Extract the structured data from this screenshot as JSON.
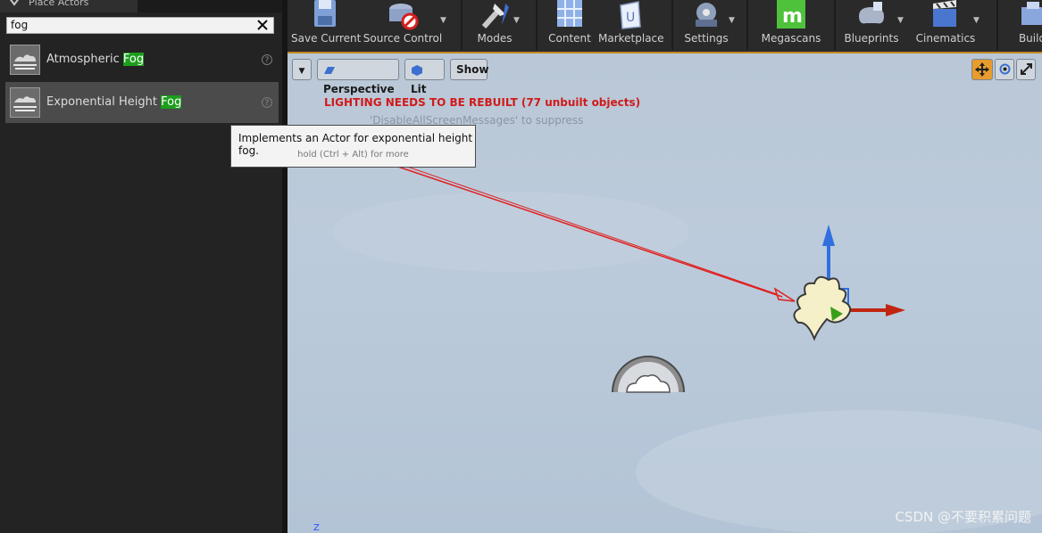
{
  "panel": {
    "tab_label": "Place Actors",
    "search_value": "fog",
    "items": [
      {
        "prefix": "Atmospheric ",
        "match": "Fog"
      },
      {
        "prefix": "Exponential Height ",
        "match": "Fog"
      }
    ],
    "help_glyph": "?"
  },
  "toolbar": {
    "buttons": [
      {
        "label": "Save Current",
        "icon": "save-icon"
      },
      {
        "label": "Source Control",
        "icon": "source-control-icon"
      },
      {
        "label": "Modes",
        "icon": "modes-icon"
      },
      {
        "label": "Content",
        "icon": "content-icon"
      },
      {
        "label": "Marketplace",
        "icon": "marketplace-icon"
      },
      {
        "label": "Settings",
        "icon": "settings-icon"
      },
      {
        "label": "Megascans",
        "icon": "megascans-icon"
      },
      {
        "label": "Blueprints",
        "icon": "blueprints-icon"
      },
      {
        "label": "Cinematics",
        "icon": "cinematics-icon"
      },
      {
        "label": "Build",
        "icon": "build-icon"
      }
    ]
  },
  "viewport": {
    "perspective_label": "Perspective",
    "lit_label": "Lit",
    "show_label": "Show",
    "warning": "LIGHTING NEEDS TO BE REBUILT (77 unbuilt objects)",
    "sub_warning": "'DisableAllScreenMessages' to suppress",
    "axis_label": "Z"
  },
  "tooltip": {
    "text": "Implements an Actor for exponential height fog.",
    "hint": "hold (Ctrl + Alt) for more"
  },
  "watermark": "CSDN @不要积累问题",
  "colors": {
    "highlight": "#1d9e1d",
    "warning": "#d11a1a",
    "viewport_border": "#c28a22",
    "megascans": "#4fc23b"
  }
}
